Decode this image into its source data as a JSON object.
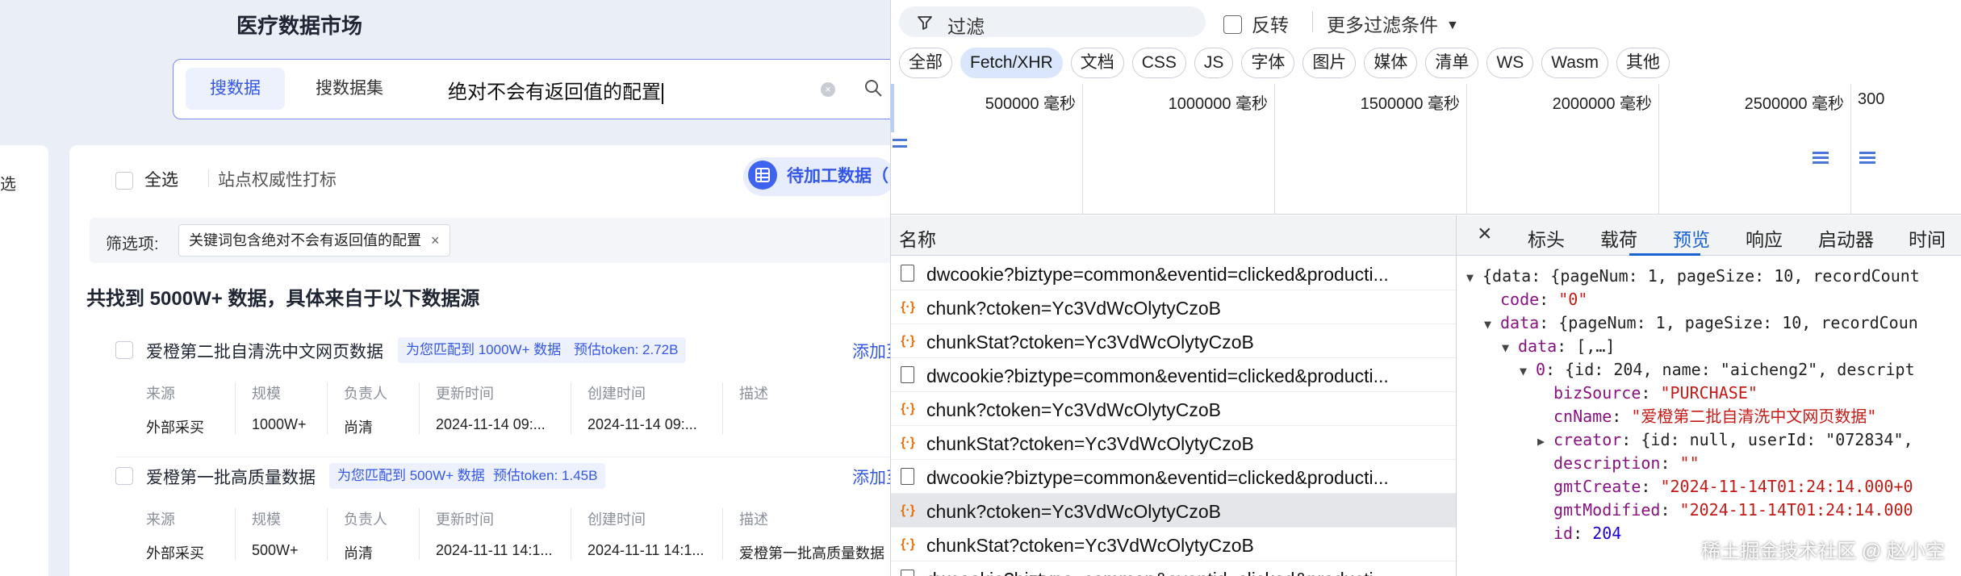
{
  "app": {
    "title": "医疗数据市场",
    "search": {
      "tabs": [
        "搜数据",
        "搜数据集"
      ],
      "query": "绝对不会有返回值的配置"
    },
    "left_strip_label": "选",
    "toolbar": {
      "select_all": "全选",
      "authority": "站点权威性打标",
      "pending": "待加工数据（"
    },
    "filter": {
      "label": "筛选项:",
      "chip": "关键词包含绝对不会有返回值的配置",
      "chip_close": "×"
    },
    "summary": "共找到 5000W+ 数据，具体来自于以下数据源",
    "meta_keys": [
      "来源",
      "规模",
      "负责人",
      "更新时间",
      "创建时间",
      "描述"
    ],
    "datasets": [
      {
        "name": "爱橙第二批自清洗中文网页数据",
        "match": "为您匹配到 1000W+ 数据",
        "token": "预估token:  2.72B",
        "add": "添加至待",
        "values": [
          "外部采买",
          "1000W+",
          "尚清",
          "2024-11-14 09:...",
          "2024-11-14 09:...",
          ""
        ]
      },
      {
        "name": "爱橙第一批高质量数据",
        "match": "为您匹配到 500W+ 数据",
        "token": "预估token:  1.45B",
        "add": "添加至待",
        "values": [
          "外部采买",
          "500W+",
          "尚清",
          "2024-11-11 14:1...",
          "2024-11-11 14:1...",
          "爱橙第一批高质量数据"
        ]
      }
    ]
  },
  "devtools": {
    "filter_placeholder": "过滤",
    "invert_label": "反转",
    "more_filters": "更多过滤条件",
    "types": [
      "全部",
      "Fetch/XHR",
      "文档",
      "CSS",
      "JS",
      "字体",
      "图片",
      "媒体",
      "清单",
      "WS",
      "Wasm",
      "其他"
    ],
    "active_type": "Fetch/XHR",
    "timeline_labels": [
      "500000 毫秒",
      "1000000 毫秒",
      "1500000 毫秒",
      "2000000 毫秒",
      "2500000 毫秒",
      "300"
    ],
    "name_header": "名称",
    "requests": [
      {
        "icon": "doc",
        "name": "dwcookie?biztype=common&eventid=clicked&producti..."
      },
      {
        "icon": "xhr",
        "name": "chunk?ctoken=Yc3VdWcOlytyCzoB"
      },
      {
        "icon": "xhr",
        "name": "chunkStat?ctoken=Yc3VdWcOlytyCzoB"
      },
      {
        "icon": "doc",
        "name": "dwcookie?biztype=common&eventid=clicked&producti..."
      },
      {
        "icon": "xhr",
        "name": "chunk?ctoken=Yc3VdWcOlytyCzoB"
      },
      {
        "icon": "xhr",
        "name": "chunkStat?ctoken=Yc3VdWcOlytyCzoB"
      },
      {
        "icon": "doc",
        "name": "dwcookie?biztype=common&eventid=clicked&producti..."
      },
      {
        "icon": "xhr",
        "name": "chunk?ctoken=Yc3VdWcOlytyCzoB",
        "selected": true
      },
      {
        "icon": "xhr",
        "name": "chunkStat?ctoken=Yc3VdWcOlytyCzoB"
      },
      {
        "icon": "doc",
        "name": "dwcookie?biztype=common&eventid=clicked&producti..."
      }
    ],
    "detail_tabs": [
      "标头",
      "载荷",
      "预览",
      "响应",
      "启动器",
      "时间"
    ],
    "active_detail_tab": "预览",
    "preview": [
      {
        "indent": 0,
        "tri": "▼",
        "key": "",
        "text": "{data: {pageNum: 1, pageSize: 10, recordCount"
      },
      {
        "indent": 1,
        "tri": "",
        "key": "code",
        "str": "\"0\""
      },
      {
        "indent": 1,
        "tri": "▼",
        "key": "data",
        "text": "{pageNum: 1, pageSize: 10, recordCoun"
      },
      {
        "indent": 2,
        "tri": "▼",
        "key": "data",
        "text": "[,…]"
      },
      {
        "indent": 3,
        "tri": "▼",
        "key": "0",
        "text": "{id: 204, name: \"aicheng2\", descript"
      },
      {
        "indent": 4,
        "tri": "",
        "key": "bizSource",
        "str": "\"PURCHASE\""
      },
      {
        "indent": 4,
        "tri": "",
        "key": "cnName",
        "str": "\"爱橙第二批自清洗中文网页数据\""
      },
      {
        "indent": 4,
        "tri": "▶",
        "key": "creator",
        "text": "{id: null, userId: \"072834\","
      },
      {
        "indent": 4,
        "tri": "",
        "key": "description",
        "str": "\"\""
      },
      {
        "indent": 4,
        "tri": "",
        "key": "gmtCreate",
        "str": "\"2024-11-14T01:24:14.000+0"
      },
      {
        "indent": 4,
        "tri": "",
        "key": "gmtModified",
        "str": "\"2024-11-14T01:24:14.000"
      },
      {
        "indent": 4,
        "tri": "",
        "key": "id",
        "num": "204"
      }
    ],
    "watermark": "稀土掘金技术社区 @ 赵小空"
  }
}
